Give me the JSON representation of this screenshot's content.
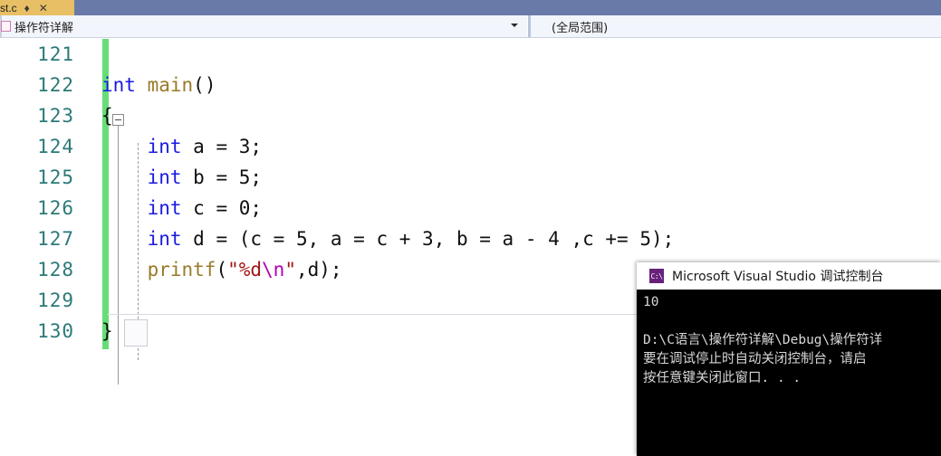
{
  "tab": {
    "title": "st.c",
    "pin_icon": "pin-icon",
    "close_icon": "close-icon"
  },
  "navbar": {
    "left": {
      "icon": "code-file-icon",
      "value": "操作符详解",
      "dropdown_icon": "chevron-down-icon"
    },
    "right": {
      "value": "(全局范围)"
    }
  },
  "editor": {
    "lines": [
      {
        "number": "121",
        "tokens": []
      },
      {
        "number": "122",
        "tokens": [
          {
            "t": "int",
            "c": "kw"
          },
          {
            "t": " ",
            "c": "punc"
          },
          {
            "t": "main",
            "c": "fn"
          },
          {
            "t": "()",
            "c": "punc"
          }
        ]
      },
      {
        "number": "123",
        "tokens": [
          {
            "t": "{",
            "c": "punc"
          }
        ]
      },
      {
        "number": "124",
        "tokens": [
          {
            "t": "    ",
            "c": "punc"
          },
          {
            "t": "int",
            "c": "kw"
          },
          {
            "t": " a = ",
            "c": "punc"
          },
          {
            "t": "3",
            "c": "num"
          },
          {
            "t": ";",
            "c": "punc"
          }
        ]
      },
      {
        "number": "125",
        "tokens": [
          {
            "t": "    ",
            "c": "punc"
          },
          {
            "t": "int",
            "c": "kw"
          },
          {
            "t": " b = ",
            "c": "punc"
          },
          {
            "t": "5",
            "c": "num"
          },
          {
            "t": ";",
            "c": "punc"
          }
        ]
      },
      {
        "number": "126",
        "tokens": [
          {
            "t": "    ",
            "c": "punc"
          },
          {
            "t": "int",
            "c": "kw"
          },
          {
            "t": " c = ",
            "c": "punc"
          },
          {
            "t": "0",
            "c": "num"
          },
          {
            "t": ";",
            "c": "punc"
          }
        ]
      },
      {
        "number": "127",
        "tokens": [
          {
            "t": "    ",
            "c": "punc"
          },
          {
            "t": "int",
            "c": "kw"
          },
          {
            "t": " d = (c = ",
            "c": "punc"
          },
          {
            "t": "5",
            "c": "num"
          },
          {
            "t": ", a = c + ",
            "c": "punc"
          },
          {
            "t": "3",
            "c": "num"
          },
          {
            "t": ", b = a - ",
            "c": "punc"
          },
          {
            "t": "4",
            "c": "num"
          },
          {
            "t": " ,c += ",
            "c": "punc"
          },
          {
            "t": "5",
            "c": "num"
          },
          {
            "t": ");",
            "c": "punc"
          }
        ]
      },
      {
        "number": "128",
        "tokens": [
          {
            "t": "    ",
            "c": "punc"
          },
          {
            "t": "printf",
            "c": "fn"
          },
          {
            "t": "(",
            "c": "punc"
          },
          {
            "t": "\"%d",
            "c": "str"
          },
          {
            "t": "\\n",
            "c": "esc"
          },
          {
            "t": "\"",
            "c": "str"
          },
          {
            "t": ",d);",
            "c": "punc"
          }
        ]
      },
      {
        "number": "129",
        "tokens": []
      },
      {
        "number": "130",
        "tokens": [
          {
            "t": "}",
            "c": "punc"
          }
        ]
      }
    ]
  },
  "console": {
    "icon_label": "C:\\",
    "title": "Microsoft Visual Studio 调试控制台",
    "lines": [
      "10",
      "",
      "D:\\C语言\\操作符详解\\Debug\\操作符详",
      "要在调试停止时自动关闭控制台，请启",
      "按任意键关闭此窗口. . ."
    ]
  }
}
